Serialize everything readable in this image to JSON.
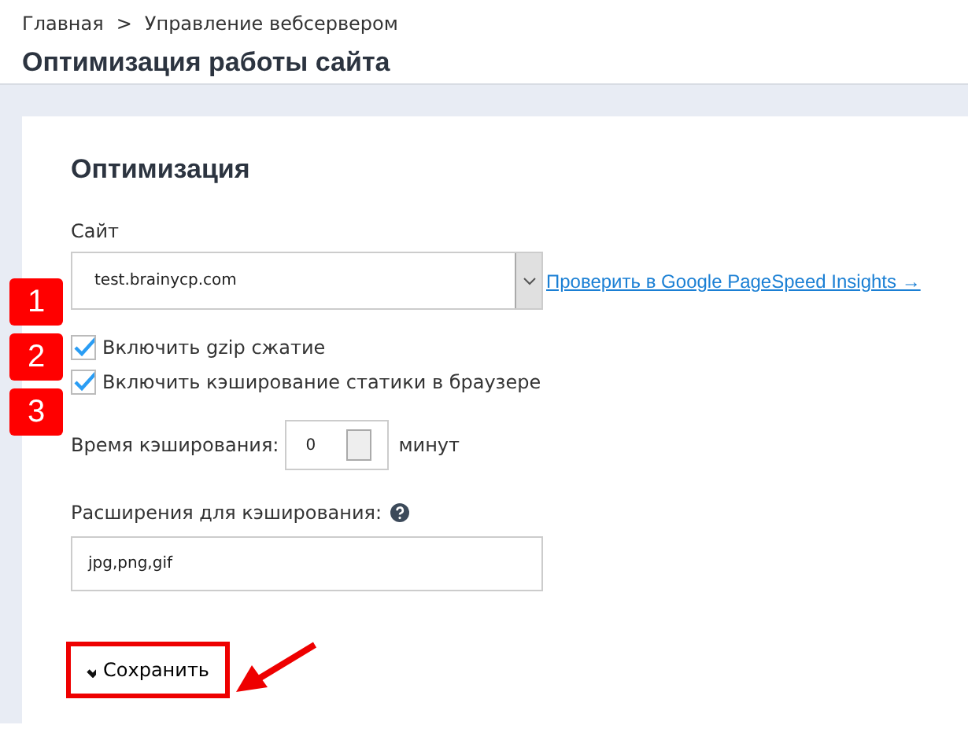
{
  "breadcrumb": {
    "items": [
      "Главная",
      "Управление вебсервером"
    ],
    "separator": ">"
  },
  "page_title": "Оптимизация работы сайта",
  "card": {
    "title": "Оптимизация",
    "site_label": "Сайт",
    "site_value": "test.brainycp.com",
    "pagespeed_link": "Проверить в Google PageSpeed Insights →",
    "checkboxes": [
      {
        "label": "Включить gzip сжатие",
        "checked": true
      },
      {
        "label": "Включить кэширование статики в браузере",
        "checked": true
      }
    ],
    "cache_time_label": "Время кэширования:",
    "cache_time_value": "0",
    "cache_time_unit": "минут",
    "extensions_label": "Расширения для кэширования:",
    "extensions_value": "jpg,png,gif",
    "save_button": "Сохранить"
  },
  "annotations": {
    "badges": [
      "1",
      "2",
      "3"
    ]
  }
}
